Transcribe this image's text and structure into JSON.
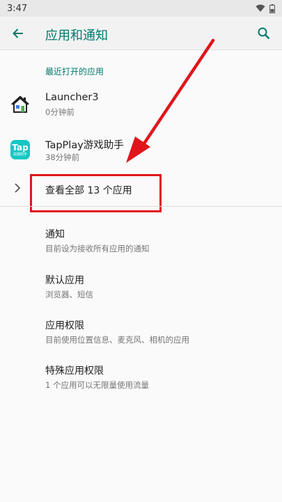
{
  "status_bar": {
    "time": "3:47"
  },
  "toolbar": {
    "title": "应用和通知"
  },
  "recent_header": "最近打开的应用",
  "recent_apps": [
    {
      "name": "Launcher3",
      "subtitle": "0分钟前",
      "icon": "house-icon"
    },
    {
      "name": "TapPlay游戏助手",
      "subtitle": "38分钟前",
      "icon": "tap-icon",
      "icon_text": "Tap",
      "icon_subtext": "加速助手"
    }
  ],
  "view_all": {
    "label": "查看全部 13 个应用"
  },
  "settings": [
    {
      "title": "通知",
      "subtitle": "目前设为接收所有应用的通知"
    },
    {
      "title": "默认应用",
      "subtitle": "浏览器、短信"
    },
    {
      "title": "应用权限",
      "subtitle": "目前使用位置信息、麦克风、相机的应用"
    },
    {
      "title": "特殊应用权限",
      "subtitle": "1 个应用可以无限量使用流量"
    }
  ],
  "colors": {
    "accent": "#00796b",
    "annotation_red": "#e0161b",
    "tap_icon": "#16c7c4"
  }
}
